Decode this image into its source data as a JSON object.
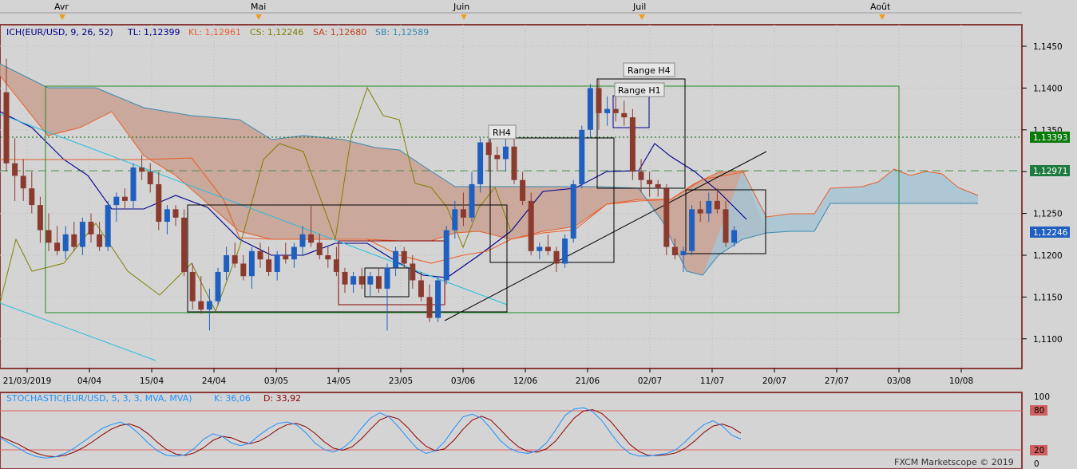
{
  "months": [
    "Avr",
    "Mai",
    "Juin",
    "Juil",
    "Août"
  ],
  "legend": {
    "ich": "ICH(EUR/USD, 9, 26, 52)",
    "tl": "TL: 1,12399",
    "kl": "KL: 1,12961",
    "cs": "CS: 1,12246",
    "sa": "SA: 1,12680",
    "sb": "SB: 1,12589"
  },
  "annotations": {
    "range_h4": "Range H4",
    "range_h1": "Range H1",
    "rh4": "RH4"
  },
  "price_labels": {
    "green": "1,13393",
    "mid": "1,12971",
    "blue": "1,12246"
  },
  "stoch": {
    "title": "STOCHASTIC(EUR/USD, 5, 3, 3, MVA, MVA)",
    "k_label": "K: 36,06",
    "d_label": "D: 33,92",
    "levels": [
      "100",
      "80",
      "20",
      "0"
    ]
  },
  "footer": "FXCM Marketscope © 2019",
  "colors": {
    "bg": "#d4d4d4",
    "bull": "#1f5fbf",
    "bear": "#8b3a2e",
    "tenkan": "#00008b",
    "kijun": "#e8602c",
    "chikou": "#808000",
    "cloud_bear": "#c8a090",
    "cloud_bull": "#a6c4d4",
    "stoch_k": "#1e90ff",
    "stoch_d": "#8b0000",
    "green": "#006400"
  },
  "chart_data": {
    "type": "candlestick",
    "title": "",
    "x_tick_labels": [
      "21/03/2019",
      "04/04",
      "15/04",
      "24/04",
      "03/05",
      "14/05",
      "23/05",
      "03/06",
      "12/06",
      "21/06",
      "02/07",
      "11/07",
      "20/07",
      "27/07",
      "03/08",
      "10/08"
    ],
    "y_tick_labels": [
      "1,1450",
      "1,1400",
      "1,1350",
      "1,1300",
      "1,1250",
      "1,1200",
      "1,1150",
      "1,1100"
    ],
    "ylim": [
      1.1065,
      1.148
    ],
    "grid": true,
    "candles": [
      [
        1.1395,
        1.1435,
        1.13,
        1.131
      ],
      [
        1.131,
        1.134,
        1.1265,
        1.1295
      ],
      [
        1.1295,
        1.1315,
        1.1265,
        1.128
      ],
      [
        1.128,
        1.13,
        1.125,
        1.126
      ],
      [
        1.126,
        1.127,
        1.1215,
        1.123
      ],
      [
        1.123,
        1.125,
        1.1205,
        1.1215
      ],
      [
        1.1215,
        1.1235,
        1.12,
        1.1205
      ],
      [
        1.1205,
        1.1235,
        1.1195,
        1.1225
      ],
      [
        1.1225,
        1.124,
        1.1205,
        1.121
      ],
      [
        1.121,
        1.1245,
        1.12,
        1.124
      ],
      [
        1.124,
        1.125,
        1.1215,
        1.1225
      ],
      [
        1.1225,
        1.124,
        1.1205,
        1.121
      ],
      [
        1.121,
        1.1265,
        1.1205,
        1.126
      ],
      [
        1.126,
        1.1275,
        1.124,
        1.127
      ],
      [
        1.127,
        1.128,
        1.1255,
        1.1265
      ],
      [
        1.1265,
        1.131,
        1.1255,
        1.1305
      ],
      [
        1.1305,
        1.132,
        1.129,
        1.13
      ],
      [
        1.13,
        1.131,
        1.1275,
        1.1285
      ],
      [
        1.1285,
        1.13,
        1.123,
        1.124
      ],
      [
        1.124,
        1.126,
        1.1225,
        1.1255
      ],
      [
        1.1255,
        1.126,
        1.1235,
        1.1245
      ],
      [
        1.1245,
        1.1255,
        1.1175,
        1.118
      ],
      [
        1.118,
        1.119,
        1.1135,
        1.1145
      ],
      [
        1.1145,
        1.1175,
        1.113,
        1.1135
      ],
      [
        1.1135,
        1.116,
        1.111,
        1.1145
      ],
      [
        1.1145,
        1.1185,
        1.114,
        1.118
      ],
      [
        1.118,
        1.121,
        1.117,
        1.12
      ],
      [
        1.12,
        1.1215,
        1.1185,
        1.119
      ],
      [
        1.119,
        1.12,
        1.117,
        1.1175
      ],
      [
        1.1175,
        1.121,
        1.116,
        1.1205
      ],
      [
        1.1205,
        1.1215,
        1.1185,
        1.1195
      ],
      [
        1.1195,
        1.121,
        1.1175,
        1.118
      ],
      [
        1.118,
        1.1205,
        1.117,
        1.12
      ],
      [
        1.12,
        1.1215,
        1.119,
        1.1195
      ],
      [
        1.1195,
        1.1215,
        1.1185,
        1.121
      ],
      [
        1.121,
        1.1235,
        1.12,
        1.1225
      ],
      [
        1.1225,
        1.126,
        1.121,
        1.1215
      ],
      [
        1.1215,
        1.1225,
        1.1195,
        1.12
      ],
      [
        1.12,
        1.121,
        1.1185,
        1.1195
      ],
      [
        1.1195,
        1.121,
        1.1175,
        1.118
      ],
      [
        1.118,
        1.1185,
        1.1155,
        1.1165
      ],
      [
        1.1165,
        1.118,
        1.1155,
        1.1175
      ],
      [
        1.1175,
        1.1185,
        1.116,
        1.1165
      ],
      [
        1.1165,
        1.118,
        1.115,
        1.1175
      ],
      [
        1.1175,
        1.1185,
        1.1155,
        1.116
      ],
      [
        1.116,
        1.119,
        1.111,
        1.1185
      ],
      [
        1.1185,
        1.121,
        1.1175,
        1.1205
      ],
      [
        1.1205,
        1.121,
        1.1185,
        1.119
      ],
      [
        1.119,
        1.12,
        1.116,
        1.117
      ],
      [
        1.117,
        1.118,
        1.1145,
        1.115
      ],
      [
        1.115,
        1.1165,
        1.112,
        1.1125
      ],
      [
        1.1125,
        1.1175,
        1.112,
        1.117
      ],
      [
        1.117,
        1.1235,
        1.1165,
        1.123
      ],
      [
        1.123,
        1.1265,
        1.122,
        1.1255
      ],
      [
        1.1255,
        1.1275,
        1.1235,
        1.1245
      ],
      [
        1.1245,
        1.13,
        1.124,
        1.1285
      ],
      [
        1.1285,
        1.134,
        1.1275,
        1.1335
      ],
      [
        1.1335,
        1.1345,
        1.13,
        1.132
      ],
      [
        1.132,
        1.133,
        1.13,
        1.1315
      ],
      [
        1.1315,
        1.134,
        1.13,
        1.133
      ],
      [
        1.133,
        1.134,
        1.1285,
        1.129
      ],
      [
        1.129,
        1.13,
        1.126,
        1.1265
      ],
      [
        1.1265,
        1.1275,
        1.12,
        1.1205
      ],
      [
        1.1205,
        1.1215,
        1.1195,
        1.121
      ],
      [
        1.121,
        1.1225,
        1.12,
        1.1205
      ],
      [
        1.1205,
        1.121,
        1.118,
        1.119
      ],
      [
        1.119,
        1.1225,
        1.1185,
        1.122
      ],
      [
        1.122,
        1.129,
        1.1215,
        1.1285
      ],
      [
        1.1285,
        1.1355,
        1.128,
        1.135
      ],
      [
        1.135,
        1.1405,
        1.134,
        1.14
      ],
      [
        1.14,
        1.141,
        1.135,
        1.137
      ],
      [
        1.137,
        1.139,
        1.1355,
        1.1375
      ],
      [
        1.1375,
        1.139,
        1.136,
        1.137
      ],
      [
        1.137,
        1.1385,
        1.1355,
        1.1365
      ],
      [
        1.1365,
        1.1375,
        1.129,
        1.13
      ],
      [
        1.13,
        1.1315,
        1.1275,
        1.129
      ],
      [
        1.129,
        1.13,
        1.127,
        1.1285
      ],
      [
        1.1285,
        1.129,
        1.127,
        1.128
      ],
      [
        1.128,
        1.1285,
        1.12,
        1.121
      ],
      [
        1.121,
        1.122,
        1.1195,
        1.12
      ],
      [
        1.12,
        1.121,
        1.118,
        1.1205
      ],
      [
        1.1205,
        1.126,
        1.12,
        1.1255
      ],
      [
        1.1255,
        1.1265,
        1.124,
        1.125
      ],
      [
        1.125,
        1.1275,
        1.124,
        1.1265
      ],
      [
        1.1265,
        1.128,
        1.125,
        1.1255
      ],
      [
        1.1255,
        1.1265,
        1.121,
        1.1215
      ],
      [
        1.1215,
        1.1235,
        1.121,
        1.123
      ]
    ],
    "stoch_k": [
      38,
      30,
      22,
      14,
      9,
      7,
      9,
      14,
      22,
      32,
      42,
      52,
      58,
      62,
      56,
      44,
      30,
      18,
      11,
      10,
      12,
      22,
      36,
      44,
      40,
      30,
      26,
      30,
      42,
      52,
      60,
      62,
      58,
      46,
      30,
      20,
      16,
      22,
      34,
      52,
      68,
      76,
      70,
      55,
      38,
      22,
      14,
      18,
      32,
      52,
      70,
      74,
      68,
      52,
      34,
      22,
      16,
      14,
      18,
      30,
      50,
      72,
      82,
      84,
      78,
      64,
      44,
      26,
      14,
      10,
      10,
      12,
      14,
      20,
      32,
      46,
      58,
      64,
      56,
      42,
      36
    ],
    "stoch_d": [
      40,
      34,
      28,
      20,
      14,
      10,
      9,
      11,
      16,
      23,
      32,
      42,
      51,
      57,
      59,
      54,
      44,
      31,
      20,
      13,
      11,
      15,
      23,
      34,
      40,
      38,
      32,
      29,
      33,
      41,
      51,
      58,
      60,
      55,
      45,
      32,
      22,
      19,
      24,
      36,
      51,
      65,
      71,
      67,
      54,
      38,
      25,
      18,
      21,
      34,
      51,
      65,
      71,
      65,
      51,
      36,
      24,
      17,
      16,
      21,
      33,
      51,
      68,
      79,
      81,
      75,
      62,
      45,
      28,
      17,
      11,
      11,
      12,
      15,
      22,
      33,
      46,
      56,
      59,
      54,
      45
    ]
  }
}
